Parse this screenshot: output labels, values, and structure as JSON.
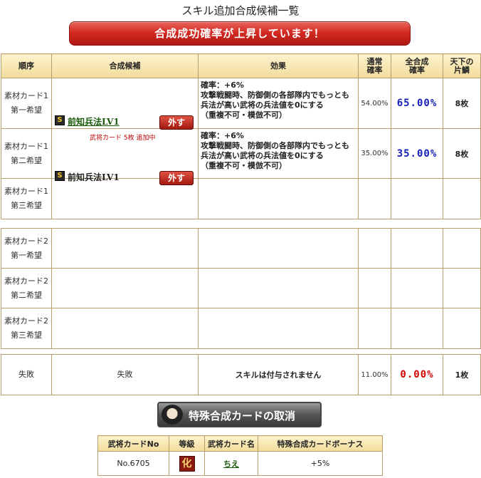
{
  "page_title": "スキル追加合成候補一覧",
  "banner": "合成成功確率が上昇しています！",
  "headers": {
    "order": "順序",
    "candidate": "合成候補",
    "effect": "効果",
    "normal_rate": [
      "通常",
      "確率"
    ],
    "total_rate": [
      "全合成",
      "確率"
    ],
    "tenka": [
      "天下の",
      "片鱗"
    ]
  },
  "group1": [
    {
      "order": [
        "素材カード1",
        "第一希望"
      ],
      "rank": "S",
      "skill": "前知兵法LV1",
      "remove": "外す",
      "note": "武将カード 5枚 追加中",
      "effect": [
        "確率：+6%",
        "攻撃戦闘時、防御側の各部隊内でもっとも兵法が高い武将の兵法値を0にする",
        "（重複不可・模倣不可）"
      ],
      "normal_rate": "54.00%",
      "total_rate": "65.00%",
      "count": "8枚"
    },
    {
      "order": [
        "素材カード1",
        "第二希望"
      ],
      "rank": "S",
      "skill": "前知兵法LV1",
      "remove": "外す",
      "effect": [
        "確率：+6%",
        "攻撃戦闘時、防御側の各部隊内でもっとも兵法が高い武将の兵法値を0にする",
        "（重複不可・模倣不可）"
      ],
      "normal_rate": "35.00%",
      "total_rate": "35.00%",
      "count": "8枚"
    },
    {
      "order": [
        "素材カード1",
        "第三希望"
      ]
    }
  ],
  "group2": [
    {
      "order": [
        "素材カード2",
        "第一希望"
      ]
    },
    {
      "order": [
        "素材カード2",
        "第二希望"
      ]
    },
    {
      "order": [
        "素材カード2",
        "第三希望"
      ]
    }
  ],
  "fail": {
    "order": "失敗",
    "candidate": "失敗",
    "effect": "スキルは付与されません",
    "normal_rate": "11.00%",
    "total_rate": "0.00%",
    "count": "1枚"
  },
  "cancel_button": "特殊合成カードの取消",
  "bonus_table": {
    "headers": [
      "武将カードNo",
      "等級",
      "武将カード名",
      "特殊合成カードボーナス"
    ],
    "row": {
      "no": "No.6705",
      "grade": "化",
      "name": "ちえ",
      "bonus": "+5%"
    }
  }
}
